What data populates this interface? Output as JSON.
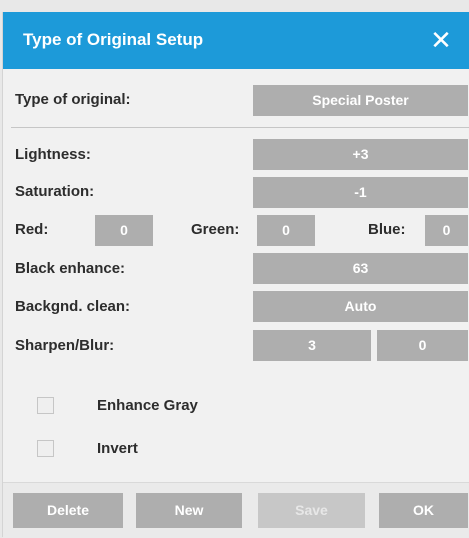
{
  "dialog": {
    "title": "Type of Original Setup",
    "close_icon": "close-icon",
    "colors": {
      "titlebar": "#1d9ad9",
      "field": "#aeaeae",
      "background": "#f1f1f1"
    }
  },
  "type_of_original": {
    "label": "Type of original:",
    "value": "Special Poster"
  },
  "lightness": {
    "label": "Lightness:",
    "value": "+3"
  },
  "saturation": {
    "label": "Saturation:",
    "value": "-1"
  },
  "red": {
    "label": "Red:",
    "value": "0"
  },
  "green": {
    "label": "Green:",
    "value": "0"
  },
  "blue": {
    "label": "Blue:",
    "value": "0"
  },
  "black_enhance": {
    "label": "Black enhance:",
    "value": "63"
  },
  "backgnd_clean": {
    "label": "Backgnd. clean:",
    "value": "Auto"
  },
  "sharpen_blur": {
    "label": "Sharpen/Blur:",
    "sharpen_value": "3",
    "blur_value": "0"
  },
  "enhance_gray": {
    "label": "Enhance Gray",
    "checked": false
  },
  "invert": {
    "label": "Invert",
    "checked": false
  },
  "footer": {
    "delete_label": "Delete",
    "new_label": "New",
    "save_label": "Save",
    "ok_label": "OK"
  }
}
